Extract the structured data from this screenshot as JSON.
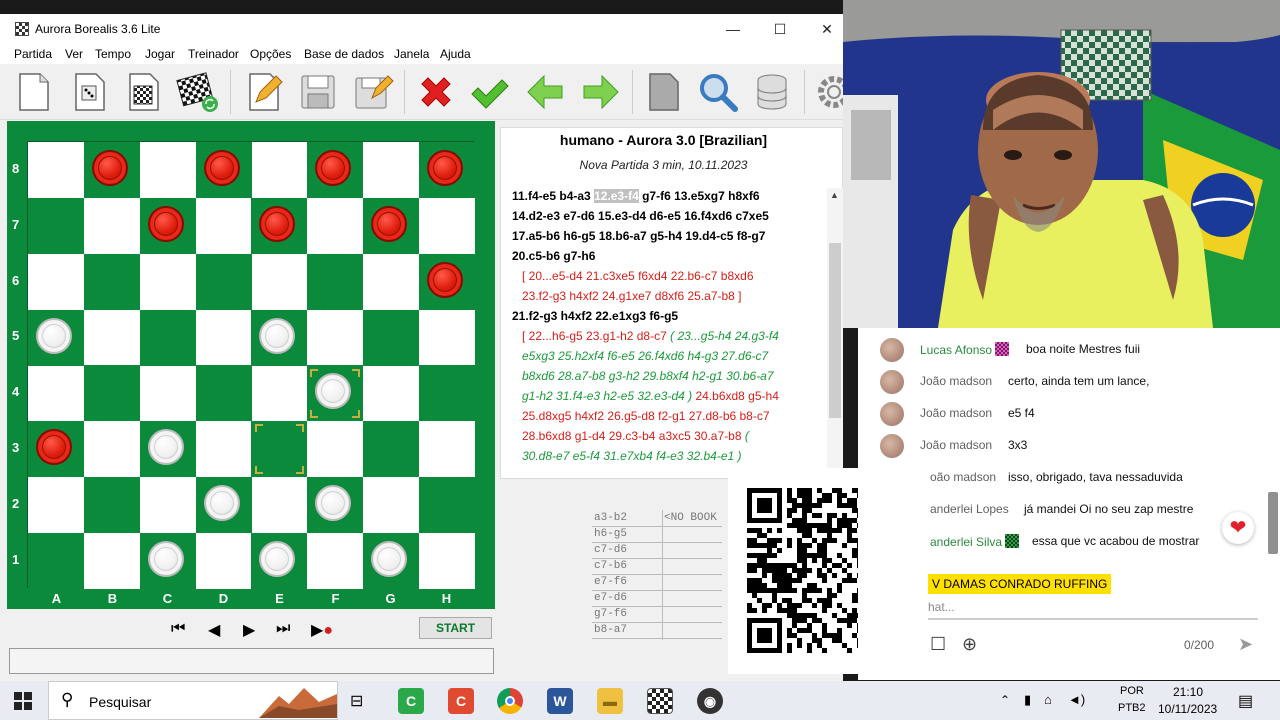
{
  "window": {
    "title": "Aurora Borealis 3.6 Lite",
    "minimize": "—",
    "maximize": "☐",
    "close": "✕"
  },
  "menu": [
    "Partida",
    "Ver",
    "Tempo",
    "Jogar",
    "Treinador",
    "Opções",
    "Base de dados",
    "Janela",
    "Ajuda"
  ],
  "toolbar": {
    "icons": [
      "new-file-icon",
      "dice-icon",
      "board-setup-icon",
      "new-game-board-icon",
      "edit-icon",
      "save-icon",
      "save-as-icon",
      "cancel-icon",
      "accept-icon",
      "back-arrow-icon",
      "forward-arrow-icon",
      "document-icon",
      "search-icon",
      "database-icon",
      "settings-icon"
    ]
  },
  "board": {
    "ranks": [
      "8",
      "7",
      "6",
      "5",
      "4",
      "3",
      "2",
      "1"
    ],
    "files": [
      "A",
      "B",
      "C",
      "D",
      "E",
      "F",
      "G",
      "H"
    ],
    "pieces": [
      {
        "sq": "b8",
        "color": "red"
      },
      {
        "sq": "d8",
        "color": "red"
      },
      {
        "sq": "f8",
        "color": "red"
      },
      {
        "sq": "h8",
        "color": "red"
      },
      {
        "sq": "c7",
        "color": "red"
      },
      {
        "sq": "e7",
        "color": "red"
      },
      {
        "sq": "g7",
        "color": "red"
      },
      {
        "sq": "h6",
        "color": "red"
      },
      {
        "sq": "a5",
        "color": "white"
      },
      {
        "sq": "e5",
        "color": "white"
      },
      {
        "sq": "f4",
        "color": "white"
      },
      {
        "sq": "a3",
        "color": "red"
      },
      {
        "sq": "c3",
        "color": "white"
      },
      {
        "sq": "d2",
        "color": "white"
      },
      {
        "sq": "f2",
        "color": "white"
      },
      {
        "sq": "c1",
        "color": "white"
      },
      {
        "sq": "e1",
        "color": "white"
      },
      {
        "sq": "g1",
        "color": "white"
      }
    ],
    "highlight_from": "e3",
    "highlight_to": "f4",
    "colors": {
      "dark": "#0a8a3a",
      "light": "#ffffff",
      "red_piece": "#e02010",
      "white_piece": "#f0f0f0"
    }
  },
  "nav": {
    "first": "⏮",
    "prev": "◀",
    "next": "▶",
    "last": "⏭",
    "play": "▶●",
    "start_label": "START"
  },
  "notation": {
    "title": "humano - Aurora 3.0 [Brazilian]",
    "subtitle": "Nova Partida 3 min, 10.11.2023",
    "lines": [
      {
        "segments": [
          {
            "t": "11.f4-e5 b4-a3 ",
            "c": "b"
          },
          {
            "t": "12.e3-f4",
            "c": "sel"
          },
          {
            "t": " g7-f6 13.e5xg7 h8xf6",
            "c": "b"
          }
        ]
      },
      {
        "segments": [
          {
            "t": "14.d2-e3 e7-d6 15.e3-d4 d6-e5 16.f4xd6 c7xe5",
            "c": "b"
          }
        ]
      },
      {
        "segments": [
          {
            "t": "17.a5-b6 h6-g5 18.b6-a7 g5-h4 19.d4-c5 f8-g7",
            "c": "b"
          }
        ]
      },
      {
        "segments": [
          {
            "t": "20.c5-b6 g7-h6",
            "c": "b"
          }
        ]
      },
      {
        "segments": [
          {
            "t": "  [ 20...e5-d4 21.c3xe5 f6xd4 22.b6-c7 b8xd6",
            "c": "r"
          }
        ]
      },
      {
        "segments": [
          {
            "t": "  23.f2-g3 h4xf2 24.g1xe7 d8xf6 25.a7-b8 ]",
            "c": "r"
          }
        ]
      },
      {
        "segments": [
          {
            "t": "21.f2-g3 h4xf2 22.e1xg3 f6-g5",
            "c": "b"
          }
        ]
      },
      {
        "segments": [
          {
            "t": "  [ 22...h6-g5 23.g1-h2 d8-c7 ",
            "c": "r"
          },
          {
            "t": "( 23...g5-h4 24.g3-f4",
            "c": "g"
          }
        ]
      },
      {
        "segments": [
          {
            "t": "  e5xg3 25.h2xf4 f6-e5 26.f4xd6 h4-g3 27.d6-c7",
            "c": "g"
          }
        ]
      },
      {
        "segments": [
          {
            "t": "  b8xd6 28.a7-b8 g3-h2 29.b8xf4 h2-g1 30.b6-a7",
            "c": "g"
          }
        ]
      },
      {
        "segments": [
          {
            "t": "  g1-h2 31.f4-e3 h2-e5 32.e3-d4 )",
            "c": "g"
          },
          {
            "t": " 24.b6xd8 g5-h4",
            "c": "r"
          }
        ]
      },
      {
        "segments": [
          {
            "t": "  25.d8xg5 h4xf2 26.g5-d8 f2-g1 27.d8-b6 b8-c7",
            "c": "r"
          }
        ]
      },
      {
        "segments": [
          {
            "t": "  28.b6xd8 g1-d4 29.c3-b4 a3xc5 30.a7-b8",
            "c": "r"
          },
          {
            "t": " (",
            "c": "g"
          }
        ]
      },
      {
        "segments": [
          {
            "t": "  30.d8-e7 e5-f4 31.e7xb4 f4-e3 32.b4-e1 )",
            "c": "g"
          }
        ]
      }
    ]
  },
  "book": {
    "header_note": "<NO BOOK",
    "moves": [
      "a3-b2",
      "h6-g5",
      "c7-d6",
      "c7-b6",
      "e7-f6",
      "e7-d6",
      "g7-f6",
      "b8-a7"
    ]
  },
  "chat": {
    "messages": [
      {
        "name": "Lucas Afonso",
        "text": "boa noite Mestres fuii",
        "green": true,
        "badge": true
      },
      {
        "name": "João madson",
        "text": "certo, ainda tem um lance,",
        "green": false,
        "badge": false
      },
      {
        "name": "João madson",
        "text": "e5 f4",
        "green": false,
        "badge": false
      },
      {
        "name": "João madson",
        "text": "3x3",
        "green": false,
        "badge": false
      },
      {
        "name": "oão madson",
        "text": "isso, obrigado, tava nessaduvida",
        "green": false,
        "badge": false
      },
      {
        "name": "anderlei Lopes",
        "text": "já mandei Oi no seu zap mestre",
        "green": false,
        "badge": false
      },
      {
        "name": "anderlei Silva",
        "text": "essa que vc acabou de mostrar",
        "green": true,
        "badge": true
      }
    ],
    "banner": "V DAMAS CONRADO RUFFING",
    "input_placeholder": "hat...",
    "counter": "0/200"
  },
  "taskbar": {
    "search_label": "Pesquisar",
    "lang": "POR",
    "layout": "PTB2",
    "time": "21:10",
    "date": "10/11/2023"
  }
}
